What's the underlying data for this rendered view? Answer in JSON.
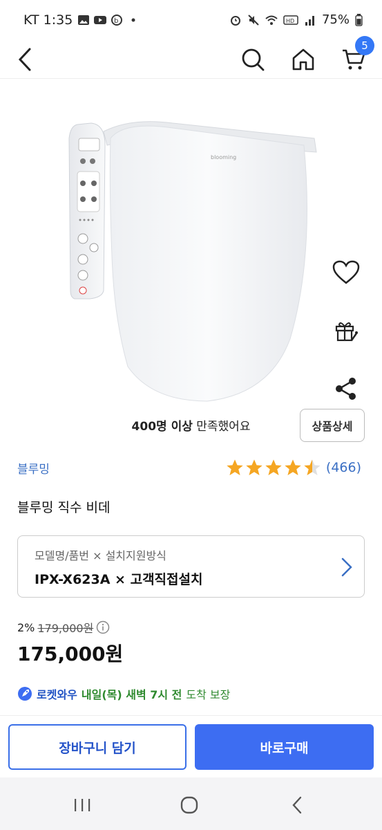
{
  "status_bar": {
    "time": "KT 1:35",
    "battery": "75%",
    "icons": [
      "image-icon",
      "youtube-icon",
      "b-icon",
      "dot-icon",
      "alarm-icon",
      "mute-icon",
      "wifi-icon",
      "hd-icon",
      "signal-icon",
      "battery-icon"
    ]
  },
  "header": {
    "cart_count": "5",
    "icons": [
      "back-arrow-icon",
      "search-icon",
      "home-icon",
      "cart-icon"
    ]
  },
  "product": {
    "image_alt": "bidet product image",
    "image_text": "blooming",
    "side_actions": [
      "heart-icon",
      "gift-icon",
      "share-icon"
    ],
    "satisfaction_bold": "400명 이상",
    "satisfaction_rest": " 만족했어요",
    "detail_button": "상품상세",
    "brand": "블루밍",
    "rating_value": 4.5,
    "review_count": "(466)",
    "title": "블루밍 직수 비데",
    "option_label": "모델명/품번 × 설치지원방식",
    "option_value": "IPX-X623A × 고객직접설치",
    "discount_rate": "2%",
    "original_price": "179,000원",
    "price": "175,000원",
    "delivery_badge": "로켓와우",
    "delivery_when": "내일(목) 새벽 7시 전",
    "delivery_rest": "도착 보장"
  },
  "actions": {
    "add_to_cart": "장바구니 담기",
    "buy_now": "바로구매"
  },
  "colors": {
    "accent": "#3d6df2",
    "brand_link": "#3a6fc4",
    "star": "#f5a623",
    "delivery_green": "#2f8a2f"
  }
}
